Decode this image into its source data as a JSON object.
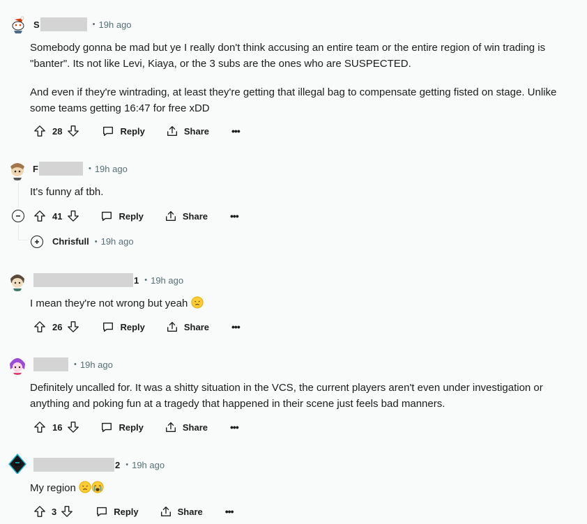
{
  "comments": [
    {
      "user_prefix": "S",
      "user_suffix": "",
      "time": "19h ago",
      "paragraphs": [
        "Somebody gonna be mad but ye I really don't think accusing an entire team or the entire region of win trading is \"banter\". Its not like Levi, Kiaya, or the 3 subs are the ones who are SUSPECTED.",
        "And even if they're wintrading, at least they're getting that illegal bag to compensate getting fisted on stage. Unlike some teams getting 16:47 for free xDD"
      ],
      "score": "28",
      "reply": "Reply",
      "share": "Share",
      "more": "•••"
    },
    {
      "user_prefix": "F",
      "user_suffix": "",
      "time": "19h ago",
      "paragraphs": [
        "It's funny af tbh."
      ],
      "score": "41",
      "reply": "Reply",
      "share": "Share",
      "more": "•••"
    },
    {
      "user_prefix": "",
      "user_suffix": "1",
      "time": "19h ago",
      "paragraphs": [
        "I mean they're not wrong but yeah"
      ],
      "score": "26",
      "reply": "Reply",
      "share": "Share",
      "more": "•••"
    },
    {
      "user_prefix": "",
      "user_suffix": "",
      "time": "19h ago",
      "paragraphs": [
        "Definitely uncalled for. It was a shitty situation in the VCS, the current players aren't even under investigation or anything and poking fun at a tragedy that happened in their scene just feels bad manners."
      ],
      "score": "16",
      "reply": "Reply",
      "share": "Share",
      "more": "•••"
    },
    {
      "user_prefix": "",
      "user_suffix": "2",
      "time": "19h ago",
      "paragraphs": [
        "My region"
      ],
      "score": "3",
      "reply": "Reply",
      "share": "Share",
      "more": "•••"
    }
  ],
  "collapsed_reply": {
    "user": "Chrisfull",
    "time": "19h ago"
  },
  "icons": [
    "upvote-icon",
    "downvote-icon",
    "reply-bubble-icon",
    "share-icon",
    "collapse-icon",
    "expand-icon",
    "sad-face-emoji",
    "crying-face-emoji"
  ],
  "colors": {
    "background": "#f9fafa",
    "meta": "#576f76",
    "redaction": "#d4d4d4"
  }
}
